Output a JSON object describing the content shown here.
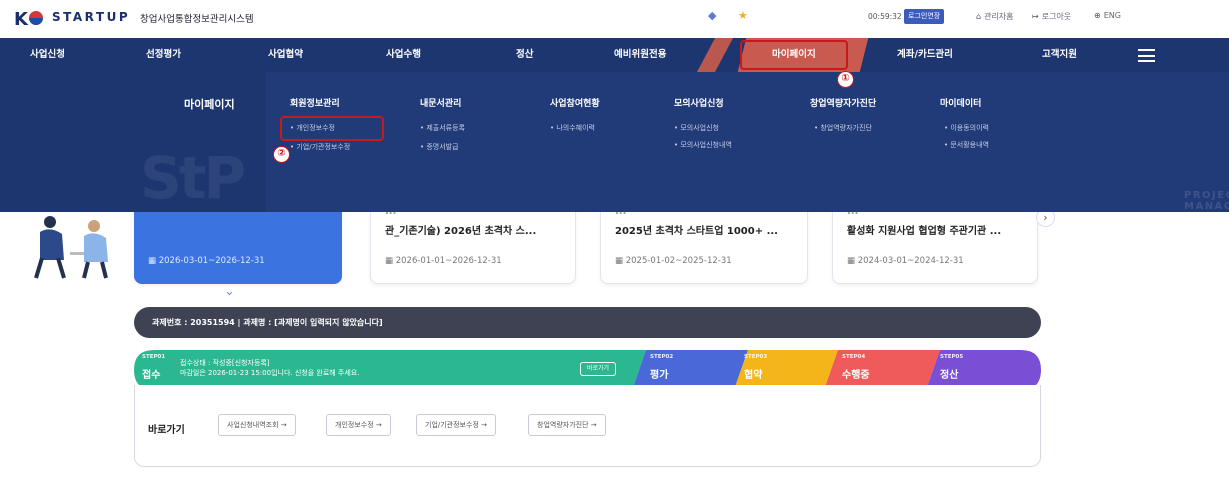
{
  "header": {
    "logo_text": "STARTUP",
    "system_name": "창업사업통합정보관리시스템",
    "timer": "00:59:32",
    "extend_label": "로그인연장",
    "links": [
      "관리자홈",
      "로그아웃",
      "ENG"
    ]
  },
  "nav": {
    "items": [
      "사업신청",
      "선정평가",
      "사업협약",
      "사업수행",
      "정산",
      "예비위원전용",
      "마이페이지",
      "계좌/카드관리",
      "고객지원"
    ]
  },
  "mega": {
    "title": "마이페이지",
    "watermark": "StP",
    "subtitle": "PROJECT MANAGEMENT SYSTEM",
    "columns": [
      {
        "head": "회원정보관리",
        "items": [
          "개인정보수정",
          "기업/기관정보수정"
        ]
      },
      {
        "head": "내문서관리",
        "items": [
          "제출서류등록",
          "증명서발급"
        ]
      },
      {
        "head": "사업참여현황",
        "items": [
          "나의수혜이력"
        ]
      },
      {
        "head": "모의사업신청",
        "items": [
          "모의사업신청",
          "모의사업신청내역"
        ]
      },
      {
        "head": "창업역량자가진단",
        "items": [
          "창업역량자가진단"
        ]
      },
      {
        "head": "마이데이터",
        "items": [
          "이용동의이력",
          "문서활용내역"
        ]
      }
    ]
  },
  "annotations": {
    "one": "①",
    "two": "②"
  },
  "cards": [
    {
      "title": "",
      "dates": "2026-03-01~2026-12-31"
    },
    {
      "title_top": "...",
      "title": "관_기존기술) 2026년 초격차 스...",
      "dates": "2026-01-01~2026-12-31"
    },
    {
      "title_top": "...",
      "title": "2025년 초격차 스타트업 1000+ ...",
      "dates": "2025-01-02~2025-12-31"
    },
    {
      "title_top": "...",
      "title": "활성화 지원사업 협업형 주관기관 ...",
      "dates": "2024-03-01~2024-12-31"
    }
  ],
  "task_bar": "과제번호 : 20351594  |  과제명 : [과제명이 입력되지 않았습니다]",
  "steps": [
    {
      "step": "STEP01",
      "name": "접수",
      "status": "접수상태 : 작성중[신청자등록]",
      "deadline": "마감일은 2026-01-23 15:00입니다. 신청을 완료해 주세요.",
      "btn": "바로가기",
      "color": "#2bb890"
    },
    {
      "step": "STEP02",
      "name": "평가",
      "color": "#4a68d8"
    },
    {
      "step": "STEP03",
      "name": "협약",
      "color": "#f3b51a"
    },
    {
      "step": "STEP04",
      "name": "수행중",
      "color": "#ef5a5a"
    },
    {
      "step": "STEP05",
      "name": "정산",
      "color": "#7a4fd6"
    }
  ],
  "quick": {
    "title": "바로가기",
    "buttons": [
      "사업신청내역조회 →",
      "개인정보수정 →",
      "기업/기관정보수정 →",
      "창업역량자가진단 →"
    ]
  }
}
